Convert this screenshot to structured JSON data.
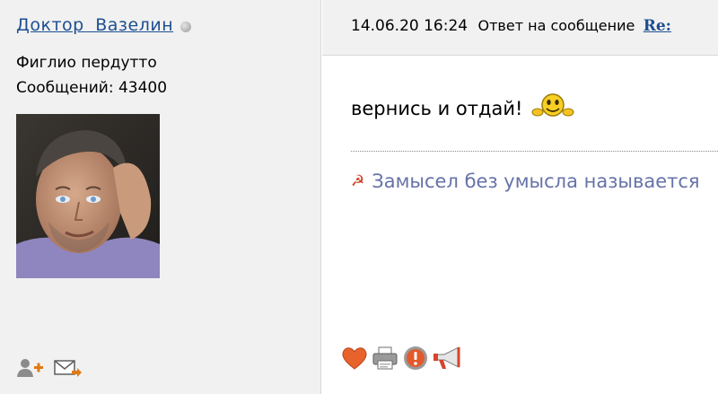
{
  "author": {
    "name": "Доктор  Вазелин",
    "title": "Фиглио пердутто",
    "post_count": "Сообщений: 43400"
  },
  "post": {
    "date": "14.06.20 16:24",
    "reply_label": "Ответ на сообщение",
    "reply_link": "Re:",
    "message": "вернись и отдай!",
    "signature": "Замысел без умысла называется"
  },
  "icons": {
    "status": "offline-status-icon",
    "smiley": "waving-smiley-icon",
    "signature": "hammer-sickle-icon",
    "add_friend": "add-friend-icon",
    "send_message": "send-message-icon",
    "like": "heart-icon",
    "print": "printer-icon",
    "report": "warning-icon",
    "promote": "megaphone-icon"
  }
}
